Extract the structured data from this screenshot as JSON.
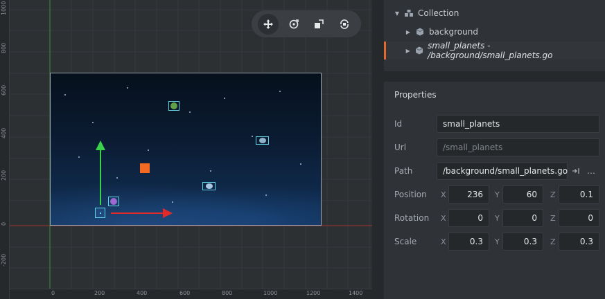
{
  "viewport": {
    "ruler_y": [
      "1000",
      "800",
      "600",
      "400",
      "200",
      "0",
      "-200"
    ],
    "ruler_x": [
      "0",
      "200",
      "400",
      "600",
      "800",
      "1000",
      "1200",
      "1400"
    ],
    "tools": [
      {
        "name": "move-tool",
        "icon": "move-arrows-icon",
        "active": true
      },
      {
        "name": "rotate-tool",
        "icon": "rotate-icon",
        "active": false
      },
      {
        "name": "scale-tool",
        "icon": "scale-icon",
        "active": false
      },
      {
        "name": "perspective-tool",
        "icon": "camera-rotate-icon",
        "active": false
      }
    ],
    "colors": {
      "x_axis": "#e22a2a",
      "y_axis": "#39d24a",
      "selection": "#62d6e8",
      "accent": "#f26a22"
    }
  },
  "outline": {
    "root": {
      "label": "Collection",
      "icon": "collection-icon",
      "expanded": true
    },
    "children": [
      {
        "label": "background",
        "icon": "game-object-icon",
        "selected": false
      },
      {
        "label": "small_planets - /background/small_planets.go",
        "icon": "game-object-icon",
        "selected": true
      }
    ]
  },
  "properties": {
    "title": "Properties",
    "id": {
      "label": "Id",
      "value": "small_planets"
    },
    "url": {
      "label": "Url",
      "value": "/small_planets"
    },
    "path": {
      "label": "Path",
      "value": "/background/small_planets.go",
      "goto_icon": "goto-icon",
      "more_label": "…"
    },
    "axis_labels": {
      "x": "X",
      "y": "Y",
      "z": "Z"
    },
    "position": {
      "label": "Position",
      "x": "236",
      "y": "60",
      "z": "0.1"
    },
    "rotation": {
      "label": "Rotation",
      "x": "0",
      "y": "0",
      "z": "0"
    },
    "scale": {
      "label": "Scale",
      "x": "0.3",
      "y": "0.3",
      "z": "0.3"
    }
  }
}
